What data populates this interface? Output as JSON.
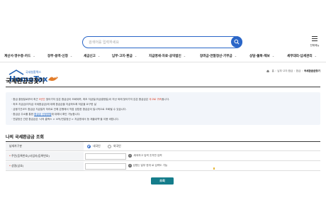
{
  "header": {
    "logo_sub": "국세청홈택스",
    "logo_main": "HomeTax",
    "search_placeholder": "검색어를 입력하세요",
    "all_menu_label": "전체메뉴"
  },
  "gnb": [
    {
      "label": "계산서·영수증·카드"
    },
    {
      "label": "장부·용역·신청"
    },
    {
      "label": "세금신고"
    },
    {
      "label": "납부·고지·환급"
    },
    {
      "label": "지급명세·자료·공익법인"
    },
    {
      "label": "장려금·연말정산·기부금"
    },
    {
      "label": "상담·불복·제보"
    },
    {
      "label": "세무대리·납세관리"
    }
  ],
  "breadcrumb": {
    "items": [
      "홈",
      "납부·고지·환급",
      "환급",
      "국세환급금찾기"
    ]
  },
  "page_title": "국세환급금찾기",
  "notice": {
    "line1_a": "· 환급 결정일로부터 최근 ",
    "line1_hl": "5년간",
    "line1_b": " 찾아가지 않은 환급금이 조회되며, 최초 지급일(지급결정일)이 지난 외에 찾아가지 않은 환급금은 ",
    "line1_hl2": "국고로 귀속",
    "line1_c": "됩니다.",
    "line2": "· 최초 지급금(미지급 국세환급금)에 대해 환급금을 지급하도록 처분을 요구한 날",
    "line3": "· 금융기관코드 환급금 지급절차 처리로 인해 은행에서 직접 성립한 환급금이 일시적으로 조회될 수 있습니다.",
    "line4_a": "· 환급금 주소를 통한 ",
    "line4_hl": "환급금 신청방법",
    "line4_b": "에 대해서 확인 가능합니다.",
    "line5": "· 연말정산 관련 환급금은 '나의 홈택스 > 소득/연말정산 > 지급명세서 등 제출내역'을 이용 바랍니다."
  },
  "section_title": "나의 국세환급금 조회",
  "form": {
    "row1_label": "납세자구분",
    "radio_domestic": "내국인",
    "radio_foreign": "외국인",
    "row2_req": "*",
    "row2_label": "주민(등록번호)/사업자(등록번호)",
    "row2_hint": "-제외하고 입력 숫자만 입력",
    "row3_req": "*",
    "row3_label": "성명(상호)",
    "row3_hint": "성명는 일부 한개 로 입력도 가능"
  },
  "submit_label": "조회",
  "colors": {
    "brand_blue": "#2a66c8",
    "button_teal": "#157d8b",
    "highlight_red": "#d9381e"
  }
}
